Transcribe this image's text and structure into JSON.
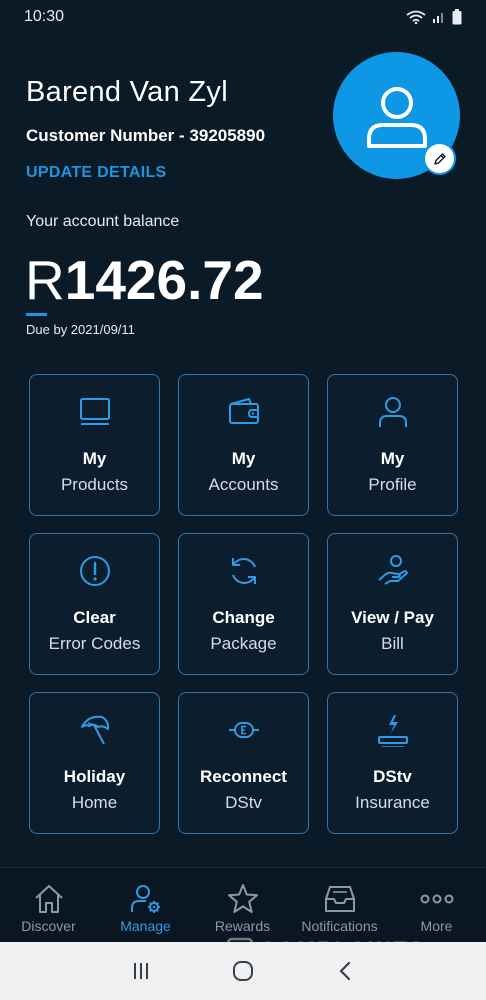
{
  "status_bar": {
    "time": "10:30"
  },
  "profile": {
    "name": "Barend Van Zyl",
    "customer_number": "Customer Number - 39205890",
    "update_link": "UPDATE DETAILS"
  },
  "account": {
    "balance_label": "Your account balance",
    "currency": "R",
    "amount": "1426.72",
    "due": "Due by 2021/09/11"
  },
  "tiles": [
    {
      "title": "My",
      "subtitle": "Products",
      "icon": "tv-icon"
    },
    {
      "title": "My",
      "subtitle": "Accounts",
      "icon": "wallet-icon"
    },
    {
      "title": "My",
      "subtitle": "Profile",
      "icon": "person-icon"
    },
    {
      "title": "Clear",
      "subtitle": "Error Codes",
      "icon": "exclamation-circle-icon"
    },
    {
      "title": "Change",
      "subtitle": "Package",
      "icon": "refresh-icon"
    },
    {
      "title": "View / Pay",
      "subtitle": "Bill",
      "icon": "hand-pay-icon"
    },
    {
      "title": "Holiday",
      "subtitle": "Home",
      "icon": "umbrella-icon"
    },
    {
      "title": "Reconnect",
      "subtitle": "DStv",
      "icon": "plug-icon"
    },
    {
      "title": "DStv",
      "subtitle": "Insurance",
      "icon": "lightning-device-icon"
    }
  ],
  "bottom_nav": {
    "active": "Manage",
    "items": [
      {
        "label": "Discover",
        "icon": "house-icon"
      },
      {
        "label": "Manage",
        "icon": "person-gear-icon"
      },
      {
        "label": "Rewards",
        "icon": "star-icon"
      },
      {
        "label": "Notifications",
        "icon": "inbox-icon"
      },
      {
        "label": "More",
        "icon": "ellipsis-icon"
      }
    ]
  },
  "watermark": {
    "text": "COMPLAINTS BOARD"
  },
  "colors": {
    "background": "#0a1a27",
    "accent": "#1f95e0",
    "tile_border": "#2b76ae",
    "avatar": "#0d97e4",
    "nav_active": "#2f9be6",
    "nav_inactive": "#8d99a4"
  }
}
